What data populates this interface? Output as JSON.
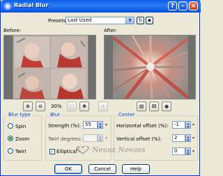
{
  "window": {
    "title": "Radial Blur",
    "title_icon": "radial-blur-app-icon"
  },
  "titlebar_buttons": [
    "help-icon",
    "minimize-icon",
    "close-icon"
  ],
  "presets": {
    "label": "Presets:",
    "value": "Last Used"
  },
  "preview": {
    "before_label": "Before:",
    "after_label": "After:",
    "zoom_level": "30%"
  },
  "blur_type": {
    "title": "Blur type",
    "options": [
      "Spin",
      "Zoom",
      "Twirl"
    ],
    "selected": "Zoom"
  },
  "blur": {
    "title": "Blur",
    "strength_label": "Strength (%):",
    "strength_value": "55",
    "twirl_label": "Twirl degrees:",
    "twirl_value": "",
    "elliptical_label": "Elliptical",
    "elliptical_checked": true
  },
  "center": {
    "title": "Center",
    "h_offset_label": "Horizontal offset (%):",
    "h_offset_value": "-1",
    "v_offset_label": "Vertical offset (%):",
    "v_offset_value": "2",
    "protect_value": "0"
  },
  "buttons": {
    "ok": "OK",
    "cancel": "Cancel",
    "help": "Help"
  },
  "watermark": "Neusa Novaes",
  "colors": {
    "accent": "#0046d5",
    "titlebar": "#0a5ee8",
    "window_bg": "#ece9d8"
  }
}
